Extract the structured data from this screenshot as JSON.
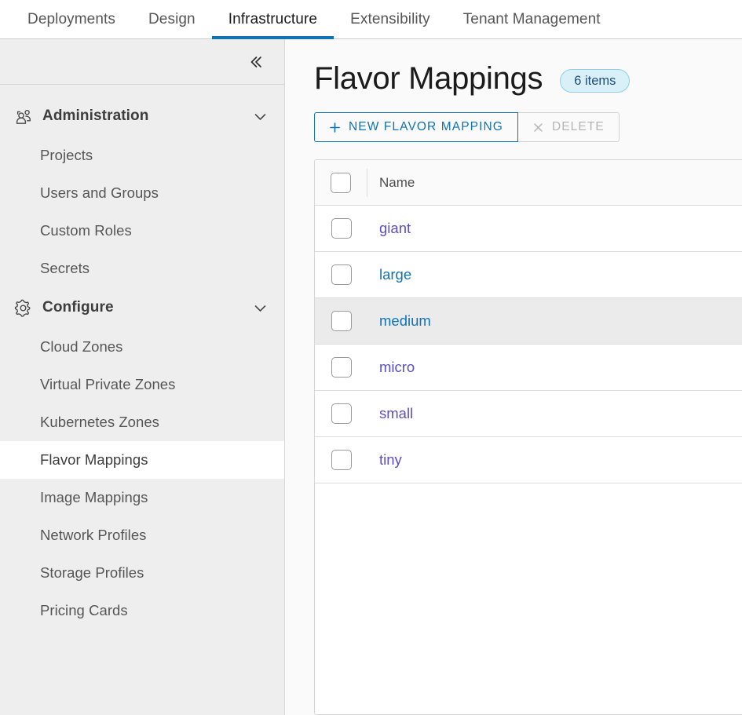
{
  "topnav": {
    "tabs": [
      {
        "label": "Deployments",
        "active": false
      },
      {
        "label": "Design",
        "active": false
      },
      {
        "label": "Infrastructure",
        "active": true
      },
      {
        "label": "Extensibility",
        "active": false
      },
      {
        "label": "Tenant Management",
        "active": false
      }
    ],
    "active_underline_color": "#0f73b5"
  },
  "sidebar": {
    "collapse_icon": "double-chevron-left-icon",
    "groups": [
      {
        "label": "Administration",
        "icon": "users-group-icon",
        "chevron": "chevron-down-icon",
        "expanded": true,
        "items": [
          {
            "label": "Projects",
            "selected": false
          },
          {
            "label": "Users and Groups",
            "selected": false
          },
          {
            "label": "Custom Roles",
            "selected": false
          },
          {
            "label": "Secrets",
            "selected": false
          }
        ]
      },
      {
        "label": "Configure",
        "icon": "gear-icon",
        "chevron": "chevron-down-icon",
        "expanded": true,
        "items": [
          {
            "label": "Cloud Zones",
            "selected": false
          },
          {
            "label": "Virtual Private Zones",
            "selected": false
          },
          {
            "label": "Kubernetes Zones",
            "selected": false
          },
          {
            "label": "Flavor Mappings",
            "selected": true
          },
          {
            "label": "Image Mappings",
            "selected": false
          },
          {
            "label": "Network Profiles",
            "selected": false
          },
          {
            "label": "Storage Profiles",
            "selected": false
          },
          {
            "label": "Pricing Cards",
            "selected": false
          }
        ]
      }
    ]
  },
  "main": {
    "title": "Flavor Mappings",
    "count_badge": "6 items",
    "toolbar": {
      "new_label": "NEW FLAVOR MAPPING",
      "new_icon": "plus-icon",
      "delete_label": "DELETE",
      "delete_icon": "close-x-icon",
      "delete_disabled": true
    },
    "table": {
      "columns": [
        "Name"
      ],
      "rows": [
        {
          "name": "giant",
          "checked": false,
          "visited": true,
          "hovered": false
        },
        {
          "name": "large",
          "checked": false,
          "visited": false,
          "hovered": false
        },
        {
          "name": "medium",
          "checked": false,
          "visited": false,
          "hovered": true
        },
        {
          "name": "micro",
          "checked": false,
          "visited": true,
          "hovered": false
        },
        {
          "name": "small",
          "checked": false,
          "visited": true,
          "hovered": false
        },
        {
          "name": "tiny",
          "checked": false,
          "visited": true,
          "hovered": false
        }
      ]
    }
  },
  "colors": {
    "accent_blue": "#0f73b5",
    "link_visited": "#5b4fc4",
    "badge_bg": "#d9f0f8",
    "badge_border": "#8ccfe8",
    "sidebar_bg": "#eeeeee",
    "main_bg": "#fafafa",
    "row_hover": "#ebebeb"
  }
}
